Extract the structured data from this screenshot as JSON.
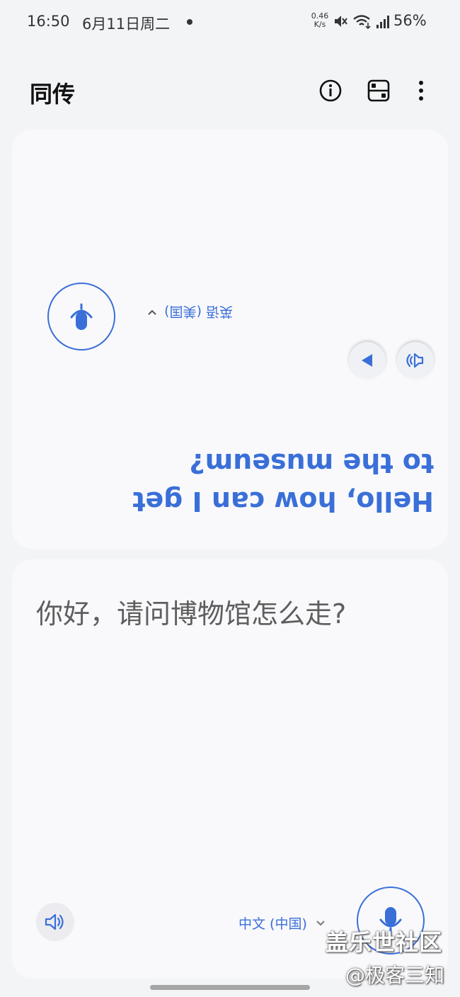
{
  "status_bar": {
    "time": "16:50",
    "date": "6月11日周二",
    "net_speed_value": "0.46",
    "net_speed_unit": "K/s",
    "battery": "56%",
    "icons": [
      "mute-icon",
      "wifi-icon",
      "signal-icon"
    ]
  },
  "header": {
    "title": "同传",
    "icons": [
      "info-icon",
      "layout-icon",
      "more-vert-icon"
    ]
  },
  "partner_panel": {
    "translated_text": "Hello, how can I get to the museum?",
    "language": "英语 (美国)",
    "icons": [
      "mic-icon",
      "play-icon",
      "speaker-icon",
      "chevron-down-icon"
    ],
    "orientation": "rotated 180"
  },
  "user_panel": {
    "source_text": "你好，请问博物馆怎么走?",
    "language": "中文 (中国)",
    "icons": [
      "speaker-icon",
      "chevron-down-icon",
      "mic-icon"
    ]
  },
  "watermark": {
    "line1": "盖乐世社区",
    "line2": "@极客三知"
  },
  "colors": {
    "accent": "#3a6fd8",
    "background": "#f3f4f6",
    "card": "#f9f9fc"
  }
}
